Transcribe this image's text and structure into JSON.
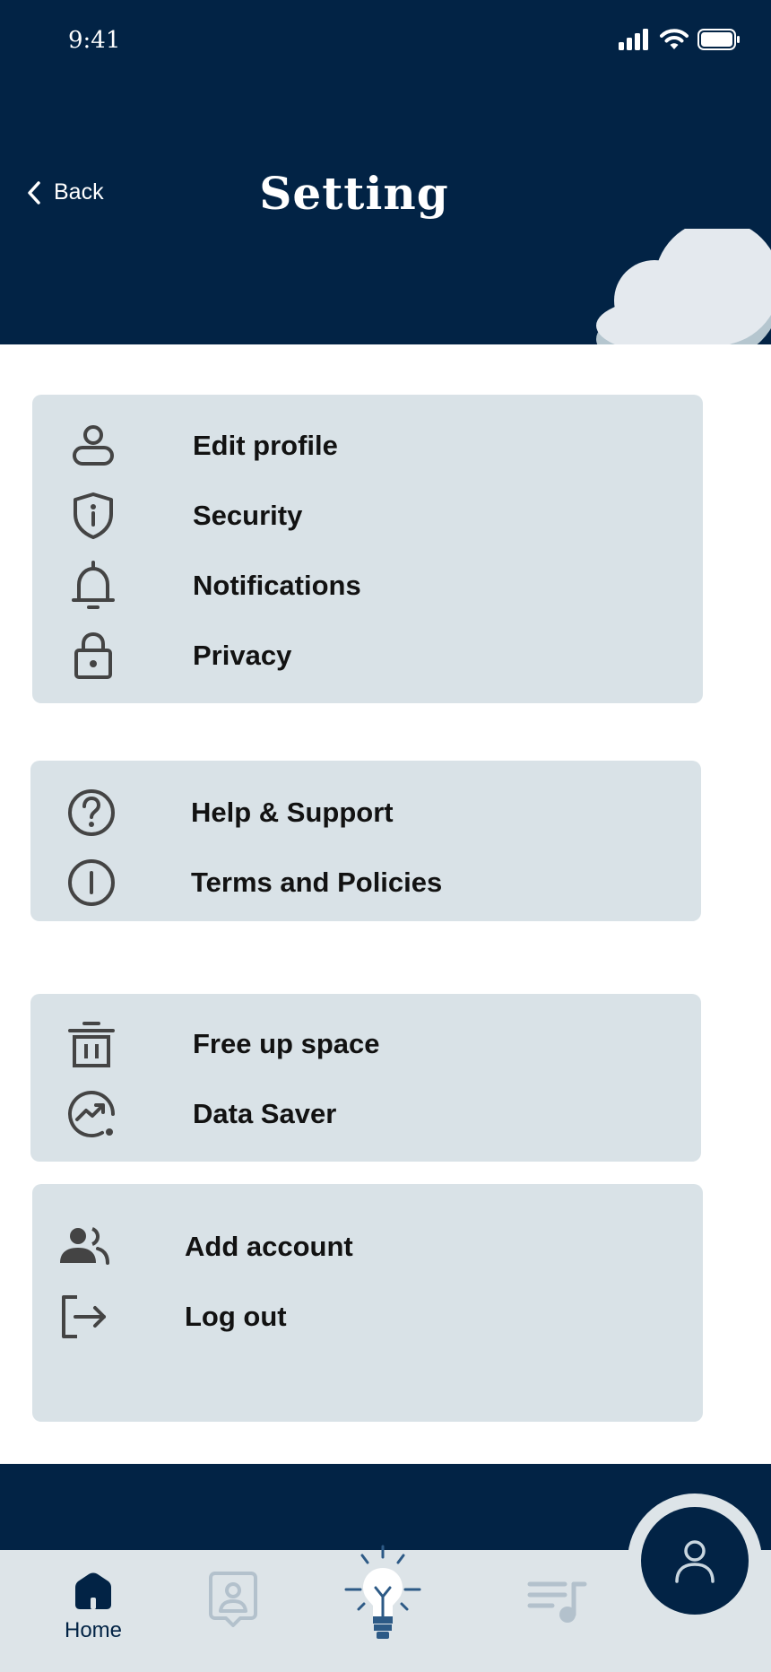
{
  "status_bar": {
    "time": "9:41"
  },
  "header": {
    "back_label": "Back",
    "title": "Setting"
  },
  "groups": [
    {
      "items": [
        {
          "label": "Edit profile",
          "icon": "person-icon"
        },
        {
          "label": "Security",
          "icon": "shield-icon"
        },
        {
          "label": "Notifications",
          "icon": "bell-icon"
        },
        {
          "label": "Privacy",
          "icon": "lock-icon"
        }
      ]
    },
    {
      "items": [
        {
          "label": "Help & Support",
          "icon": "help-icon"
        },
        {
          "label": "Terms and Policies",
          "icon": "info-icon"
        }
      ]
    },
    {
      "items": [
        {
          "label": "Free up space",
          "icon": "trash-icon"
        },
        {
          "label": "Data Saver",
          "icon": "data-saver-icon"
        }
      ]
    },
    {
      "items": [
        {
          "label": "Add account",
          "icon": "people-icon"
        },
        {
          "label": "Log out",
          "icon": "logout-icon"
        }
      ]
    }
  ],
  "tabbar": {
    "home_label": "Home"
  },
  "colors": {
    "navy": "#022345",
    "card": "#d9e2e7",
    "tabbar": "#dde4e8",
    "inactive_tab": "#b3c1cc"
  }
}
